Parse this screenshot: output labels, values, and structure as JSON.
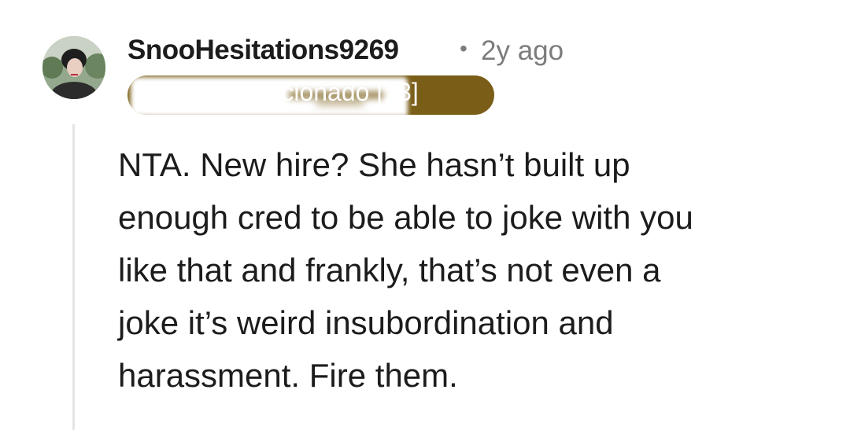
{
  "comment": {
    "author": "SnooHesitations9269",
    "separator": "•",
    "timestamp": "2y ago",
    "flair": {
      "text": "Aficionado [13]",
      "color": "#7a5e18"
    },
    "body_lines": [
      "NTA. New hire? She hasn’t built up",
      "enough cred to be able to joke with you",
      "like that and frankly, that’s not even a",
      "joke it’s weird insubordination and",
      "harassment. Fire them."
    ]
  }
}
